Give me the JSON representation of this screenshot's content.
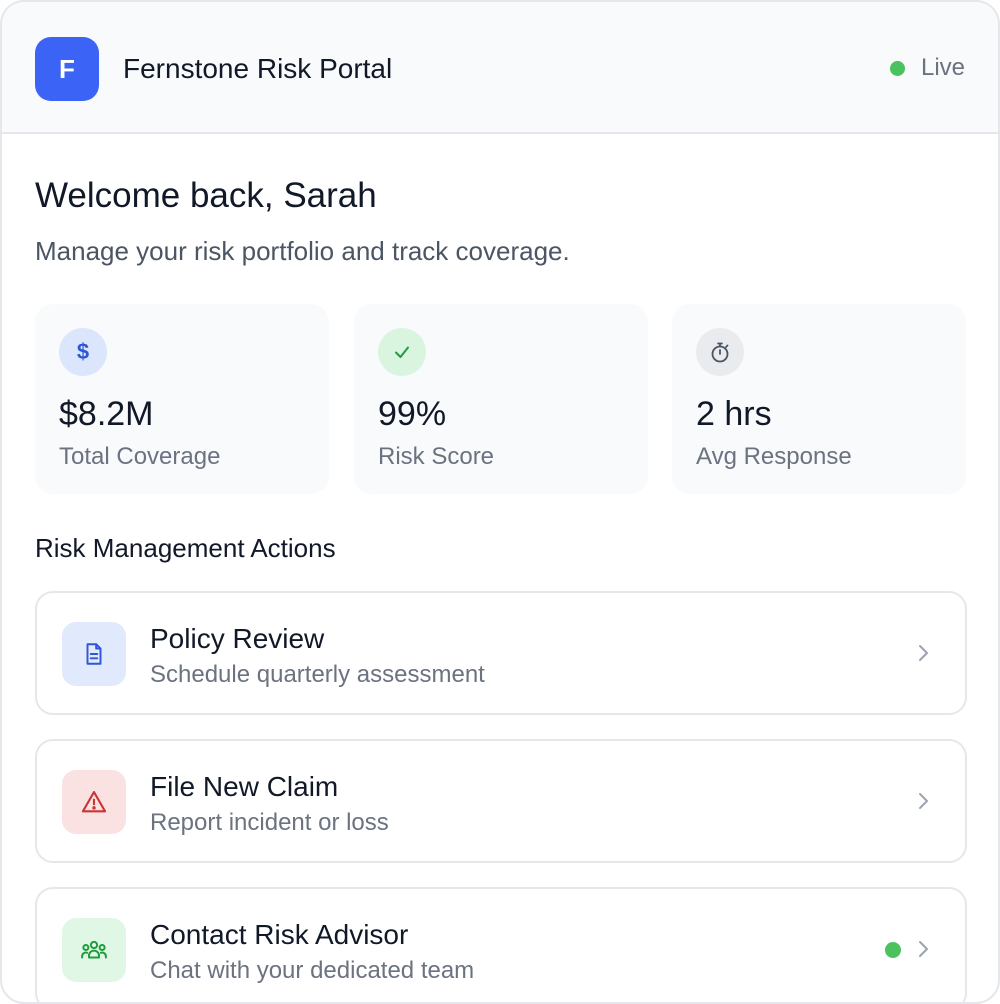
{
  "header": {
    "logo_letter": "F",
    "app_title": "Fernstone Risk Portal",
    "status_label": "Live",
    "brand_color": "#3b63f6",
    "status_color": "#4ac25d"
  },
  "welcome": {
    "heading": "Welcome back, Sarah",
    "subtitle": "Manage your risk portfolio and track coverage."
  },
  "stats": [
    {
      "icon": "dollar-icon",
      "value": "$8.2M",
      "label": "Total Coverage"
    },
    {
      "icon": "check-icon",
      "value": "99%",
      "label": "Risk Score"
    },
    {
      "icon": "stopwatch-icon",
      "value": "2 hrs",
      "label": "Avg Response"
    }
  ],
  "actions_section": {
    "title": "Risk Management Actions",
    "items": [
      {
        "icon": "document-icon",
        "title": "Policy Review",
        "description": "Schedule quarterly assessment",
        "has_status_dot": false
      },
      {
        "icon": "warning-icon",
        "title": "File New Claim",
        "description": "Report incident or loss",
        "has_status_dot": false
      },
      {
        "icon": "team-icon",
        "title": "Contact Risk Advisor",
        "description": "Chat with your dedicated team",
        "has_status_dot": true
      }
    ]
  }
}
